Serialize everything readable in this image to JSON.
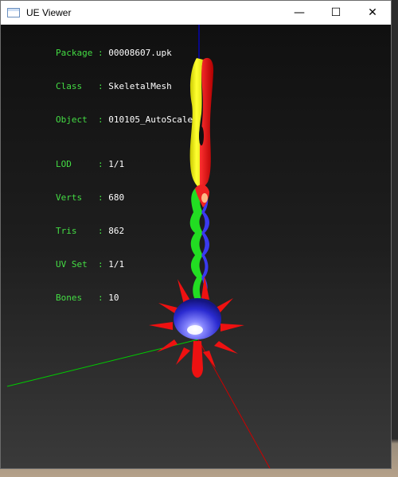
{
  "window": {
    "title": "UE Viewer",
    "minimize_glyph": "—",
    "maximize_glyph": "☐",
    "close_glyph": "✕"
  },
  "info": {
    "package": {
      "key": "Package",
      "value": "00008607.upk"
    },
    "class": {
      "key": "Class  ",
      "value": "SkeletalMesh"
    },
    "object": {
      "key": "Object ",
      "value": "010105_AutoScale"
    },
    "lod": {
      "key": "LOD    ",
      "value": "1/1"
    },
    "verts": {
      "key": "Verts  ",
      "value": "680"
    },
    "tris": {
      "key": "Tris   ",
      "value": "862"
    },
    "uvset": {
      "key": "UV Set ",
      "value": "1/1"
    },
    "bones": {
      "key": "Bones  ",
      "value": "10"
    }
  },
  "colors": {
    "label": "#44dd44",
    "value": "#ffffff",
    "axis_x": "#cc0000",
    "axis_y": "#00cc00",
    "axis_z": "#0000ff"
  }
}
